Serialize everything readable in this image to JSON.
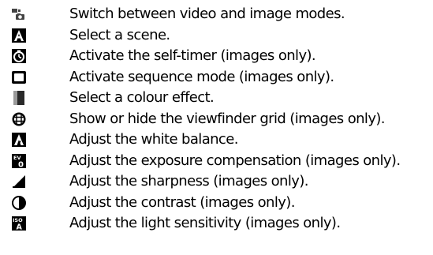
{
  "items": [
    {
      "icon": "camera-video-switch-icon",
      "label": "Switch between video and image modes."
    },
    {
      "icon": "scene-auto-icon",
      "label": "Select a scene."
    },
    {
      "icon": "self-timer-icon",
      "label": "Activate the self-timer (images only)."
    },
    {
      "icon": "sequence-mode-icon",
      "label": "Activate sequence mode (images only)."
    },
    {
      "icon": "colour-effect-icon",
      "label": "Select a colour effect."
    },
    {
      "icon": "viewfinder-grid-icon",
      "label": "Show or hide the viewfinder grid (images only)."
    },
    {
      "icon": "white-balance-icon",
      "label": "Adjust the white balance."
    },
    {
      "icon": "exposure-compensation-icon",
      "label": "Adjust the exposure compensation (images only)."
    },
    {
      "icon": "sharpness-icon",
      "label": "Adjust the sharpness (images only)."
    },
    {
      "icon": "contrast-icon",
      "label": "Adjust the contrast (images only)."
    },
    {
      "icon": "iso-icon",
      "label": "Adjust the light sensitivity (images only).",
      "icon_text": [
        "ISO",
        "A"
      ]
    }
  ],
  "exposure_icon_text": [
    "EV",
    "0"
  ]
}
